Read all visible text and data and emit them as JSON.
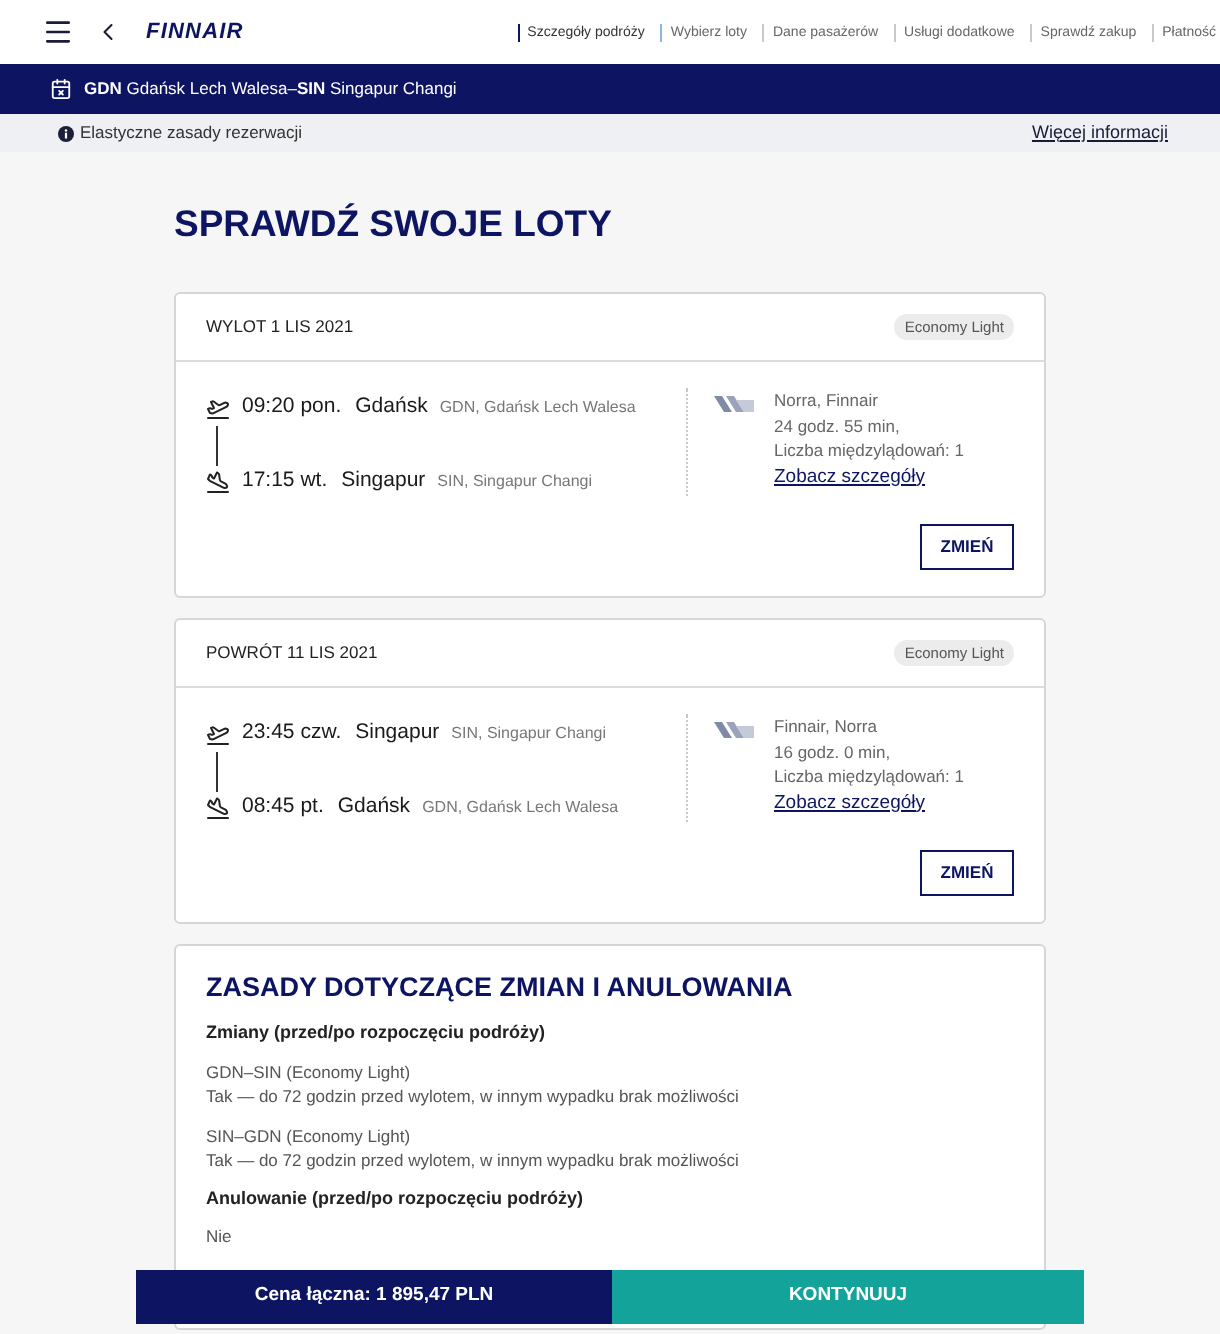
{
  "header": {
    "logo": "FINNAIR",
    "steps": [
      {
        "label": "Szczegóły podróży",
        "completed": true,
        "selected": false
      },
      {
        "label": "Wybierz loty",
        "completed": false,
        "selected": true
      },
      {
        "label": "Dane pasażerów",
        "completed": false,
        "selected": false
      },
      {
        "label": "Usługi dodatkowe",
        "completed": false,
        "selected": false
      },
      {
        "label": "Sprawdź zakup",
        "completed": false,
        "selected": false
      },
      {
        "label": "Płatność",
        "completed": false,
        "selected": false
      }
    ]
  },
  "route_bar": {
    "text": "**GDN** Gdańsk Lech Walesa–**SIN** Singapur Changi"
  },
  "info_bar": {
    "text": "Elastyczne zasady rezerwacji",
    "link": "Więcej informacji"
  },
  "page_title": "SPRAWDŹ SWOJE LOTY",
  "flights": [
    {
      "heading": "WYLOT 1 LIS 2021",
      "fare": "Economy Light",
      "segments": [
        {
          "kind": "departure",
          "time": "09:20 pon.",
          "city": "Gdańsk",
          "airport": "GDN, Gdańsk Lech Walesa"
        },
        {
          "kind": "arrival",
          "time": "17:15 wt.",
          "city": "Singapur",
          "airport": "SIN, Singapur Changi"
        }
      ],
      "airlines": "Norra, Finnair",
      "duration": "24 godz. 55 min,",
      "stops": "Liczba międzylądowań: 1",
      "details_link": "Zobacz szczegóły",
      "change_button": "ZMIEŃ"
    },
    {
      "heading": "POWRÓT 11 LIS 2021",
      "fare": "Economy Light",
      "segments": [
        {
          "kind": "departure",
          "time": "23:45 czw.",
          "city": "Singapur",
          "airport": "SIN, Singapur Changi"
        },
        {
          "kind": "arrival",
          "time": "08:45 pt.",
          "city": "Gdańsk",
          "airport": "GDN, Gdańsk Lech Walesa"
        }
      ],
      "airlines": "Finnair, Norra",
      "duration": "16 godz. 0 min,",
      "stops": "Liczba międzylądowań: 1",
      "details_link": "Zobacz szczegóły",
      "change_button": "ZMIEŃ"
    }
  ],
  "rules": {
    "title": "ZASADY DOTYCZĄCE ZMIAN I ANULOWANIA",
    "sections": [
      {
        "kind": "heading",
        "text": "Zmiany (przed/po rozpoczęciu podróży)"
      },
      {
        "kind": "route_rule",
        "route": "GDN–SIN (Economy Light)",
        "text": "Tak — do 72 godzin przed wylotem, w innym wypadku brak możliwości"
      },
      {
        "kind": "route_rule",
        "route": "SIN–GDN (Economy Light)",
        "text": "Tak — do 72 godzin przed wylotem, w innym wypadku brak możliwości"
      },
      {
        "kind": "heading",
        "text": "Anulowanie (przed/po rozpoczęciu podróży)"
      },
      {
        "kind": "plain",
        "text": "Nie"
      }
    ]
  },
  "footer": {
    "total": "Cena łączna: 1 895,47 PLN",
    "continue_button": "KONTYNUUJ"
  }
}
